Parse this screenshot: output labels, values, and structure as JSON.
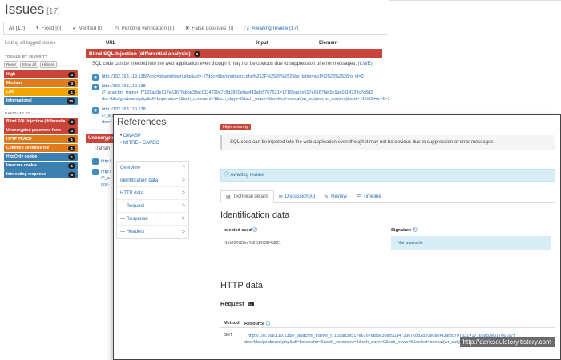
{
  "page": {
    "title": "Issues",
    "count": "[17]",
    "listing_text": "Listing all logged issues",
    "columns": {
      "url": "URL",
      "input": "Input",
      "element": "Element"
    }
  },
  "tabs": [
    {
      "label": "All [17]",
      "icon": ""
    },
    {
      "label": "Fixed [0]",
      "icon": "circle-icon"
    },
    {
      "label": "Verified [0]",
      "icon": "check-icon"
    },
    {
      "label": "Pending verification [0]",
      "icon": "clock-icon"
    },
    {
      "label": "False positives [0]",
      "icon": "x-icon"
    },
    {
      "label": "Awaiting review [17]",
      "icon": "info-icon"
    }
  ],
  "sidebar": {
    "severity_heading": "TOGGLE BY SEVERITY",
    "severity_buttons": [
      "Reset",
      "Show all",
      "Hide all"
    ],
    "severities": [
      {
        "label": "High",
        "count": "3",
        "color": "#c9453a"
      },
      {
        "label": "Medium",
        "count": "3",
        "color": "#e07a1f"
      },
      {
        "label": "Low",
        "count": "1",
        "color": "#f0a500"
      },
      {
        "label": "Informational",
        "count": "10",
        "color": "#3c7fb1"
      }
    ],
    "navigate_heading": "NAVIGATE TO",
    "issues": [
      {
        "label": "Blind SQL Injection (differentia",
        "count": "3",
        "color": "#c9453a"
      },
      {
        "label": "Unencrypted password form",
        "count": "3",
        "color": "#c9453a"
      },
      {
        "label": "HTTP TRACE",
        "count": "1",
        "color": "#e07a1f"
      },
      {
        "label": "Common sensitive file",
        "count": "1",
        "color": "#e07a1f"
      },
      {
        "label": "HttpOnly cookie",
        "count": "1",
        "color": "#3c7fb1"
      },
      {
        "label": "Insecure cookie",
        "count": "1",
        "color": "#3c7fb1"
      },
      {
        "label": "Interesting response",
        "count": "6",
        "color": "#3c7fb1"
      }
    ]
  },
  "issue": {
    "name": "Blind SQL Injection (differential analysis)",
    "count": "3",
    "description": "SQL code can be injected into the web application even though it may not be obvious due to suppression of error messages.",
    "cwe": "(CWE)",
    "urls": [
      {
        "lines": [
          "http://192.168.119.138/?doc=bbs/mblogin.php&url=../?doc=bbs/gnuboard.php%253F%2526%2526bo_table=ab1%2526%2526ro_id=2"
        ]
      },
      {
        "lines": [
          "http://192.168.119.138",
          "/?_anachni_trainer_f7165ab3e517e6167fab5e39ac0114729c7c8d2820e0aef43afb5707531=17165ab3e517e6167fab5e9ac0114729c7c8d2",
          "doc=bbs/gnuboard.php&sfl=boperator=1&sch_comment=1&sch_days=0&sch_news=5&select=concat(wr_subject,wr_content)&stxt=~1%22+or+1=1"
        ]
      },
      {
        "lines": [
          "http://192.168.119.138",
          "/?_an",
          "doc="
        ]
      }
    ],
    "unencrypted_label": "Unencrypted",
    "transmitted_label": "Transm",
    "frag1": "http:/",
    "frag2": "http:/",
    "frag3": "/?_a",
    "frag4": "doc-"
  },
  "panel": {
    "references_title": "References",
    "references": [
      "OWASP",
      "MITRE - CAPEC"
    ],
    "nav": [
      {
        "label": "Overview",
        "chev": "^"
      },
      {
        "label": "Identification data",
        "chev": ">"
      },
      {
        "label": "HTTP data",
        "chev": ">"
      },
      {
        "label": "— Request",
        "chev": ">"
      },
      {
        "label": "— Response",
        "chev": ">"
      },
      {
        "label": "— Headers",
        "chev": ">"
      }
    ],
    "severity_badge": "High severity",
    "description": "SQL code can be injected into the web application even though it may not be obvious due to suppression of error messages.",
    "awaiting_review": "Awaiting review",
    "subtabs": [
      {
        "label": "Technical details",
        "icon": "doc-icon"
      },
      {
        "label": "Discussion [0]",
        "icon": "chat-icon"
      },
      {
        "label": "Review",
        "icon": "edit-icon"
      },
      {
        "label": "Timeline",
        "icon": "list-icon"
      }
    ],
    "identification": {
      "heading": "Identification data",
      "col_seed": "Injected seed",
      "col_signature": "Signature",
      "seed_value": "-1%22%20or%201%3D%221",
      "signature_value": "Not available"
    },
    "http": {
      "heading": "HTTP data",
      "request_label": "Request",
      "col_method": "Method",
      "col_resource": "Resource",
      "method": "GET",
      "resource_line1": "http://192.168.119.138/?_anachni_trainer_f7165ab3e517e6167fab5e39ac0114729c7c8d2820e0aef43afb5707531=17165ab3e517e6167f",
      "resource_line2": "doc=bbs/gnuboard.php&sfl=boperator=1&sch_comment=1&sch_days=0&sch_news=5&select=concat(wr_subject,wr_content)&stxt=~1%22"
    }
  },
  "watermark": "http://darksoulstory.tistory.com"
}
